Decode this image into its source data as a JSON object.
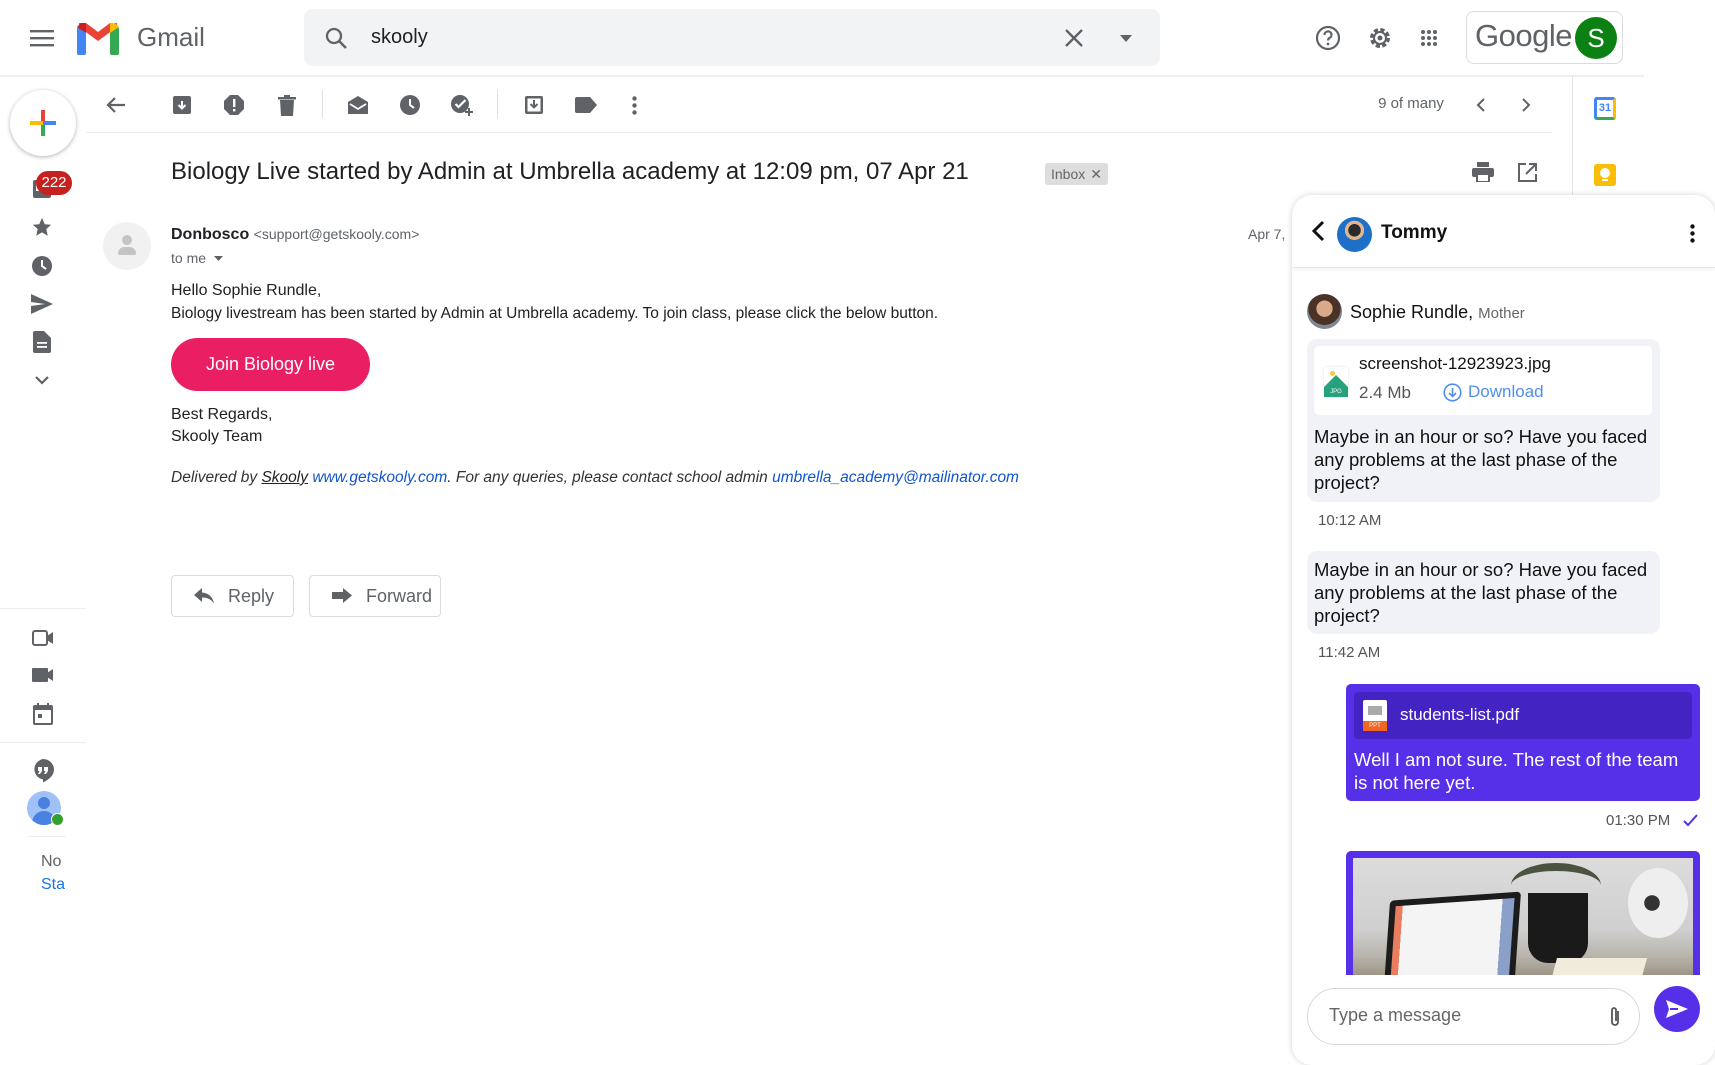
{
  "header": {
    "app_name": "Gmail",
    "search_value": "skooly",
    "google_label": "Google",
    "account_initial": "S",
    "account_color": "#0b8113"
  },
  "sidebar": {
    "inbox_badge": "222",
    "footer_text_1": "No",
    "footer_link": "Sta"
  },
  "toolbar": {
    "pagination": "9 of many"
  },
  "email": {
    "subject": "Biology Live started by Admin at Umbrella academy at 12:09 pm, 07 Apr 21",
    "label": "Inbox",
    "sender_name": "Donbosco",
    "sender_email": "<support@getskooly.com>",
    "recipient": "to me",
    "date": "Apr 7,",
    "greeting": "Hello Sophie Rundle,",
    "body": "Biology livestream has been started by Admin at Umbrella academy. To join class, please click the below button.",
    "cta_label": "Join Biology live",
    "cta_color": "#e91e63",
    "regards_1": "Best Regards,",
    "regards_2": "Skooly Team",
    "footer_prefix": "Delivered by ",
    "footer_brand": "Skooly",
    "footer_site": "www.getskooly.com",
    "footer_middle": ". For any queries, please contact school admin ",
    "footer_email": "umbrella_academy@mailinator.com",
    "reply_label": "Reply",
    "forward_label": "Forward"
  },
  "chat": {
    "contact_name": "Tommy",
    "accent_color": "#5630e9",
    "sender_name": "Sophie Rundle,",
    "sender_role": "Mother",
    "messages": [
      {
        "file_name": "screenshot-12923923.jpg",
        "file_size": "2.4 Mb",
        "download_label": "Download",
        "text": "Maybe in an hour or so? Have you faced any problems at the last phase of the project?",
        "time": "10:12 AM"
      },
      {
        "text": "Maybe in an hour or so? Have you faced any problems at the last phase of the project?",
        "time": "11:42 AM"
      },
      {
        "file_name": "students-list.pdf",
        "file_badge": "PPT",
        "text": "Well I am not sure. The rest of the team is not here yet.",
        "time": "01:30 PM",
        "status": "read"
      }
    ],
    "input_placeholder": "Type a message"
  }
}
